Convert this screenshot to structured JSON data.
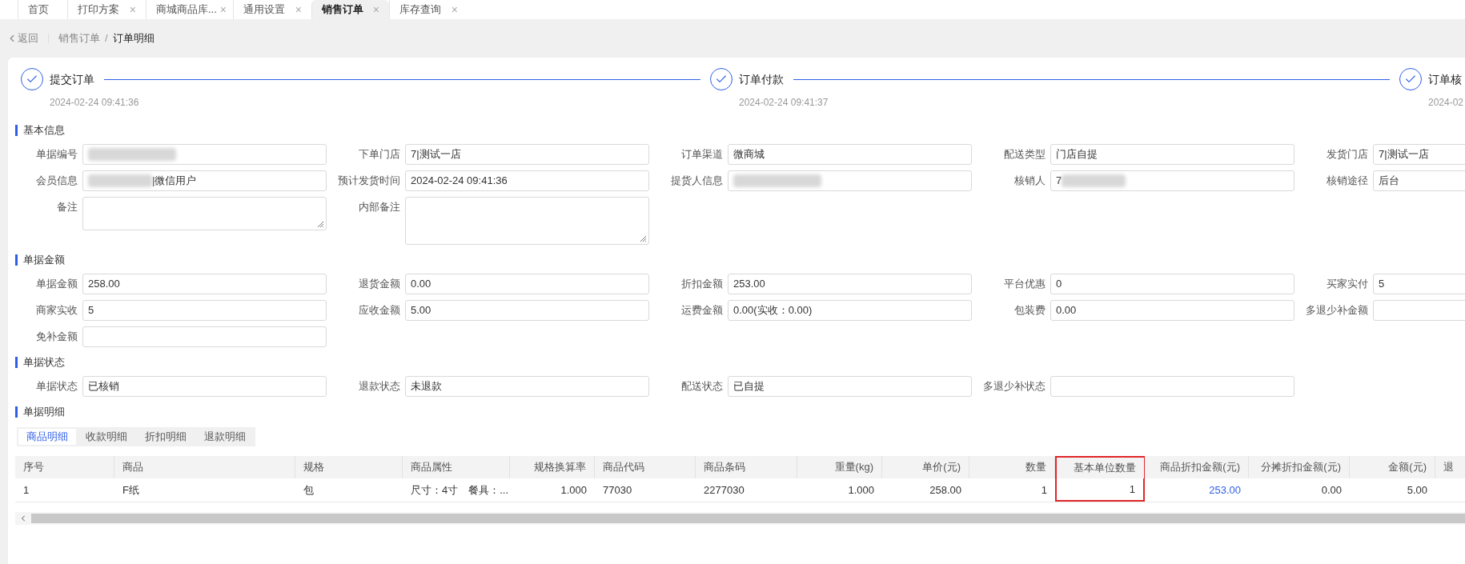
{
  "tabs": [
    {
      "label": "首页",
      "closable": false,
      "selected": false
    },
    {
      "label": "打印方案",
      "closable": true,
      "selected": false
    },
    {
      "label": "商城商品库...",
      "closable": true,
      "selected": false
    },
    {
      "label": "通用设置",
      "closable": true,
      "selected": false
    },
    {
      "label": "销售订单",
      "closable": true,
      "selected": true
    },
    {
      "label": "库存查询",
      "closable": true,
      "selected": false
    }
  ],
  "close_glyph": "×",
  "breadcrumb": {
    "back": "返回",
    "items": [
      "销售订单",
      "订单明细"
    ],
    "separator": "/"
  },
  "steps": [
    {
      "label": "提交订单",
      "time": "2024-02-24 09:41:36",
      "done": true
    },
    {
      "label": "订单付款",
      "time": "2024-02-24 09:41:37",
      "done": true
    },
    {
      "label": "订单核",
      "time": "2024-02",
      "done": true
    }
  ],
  "sections": [
    {
      "title": "基本信息",
      "rows": [
        [
          {
            "label": "单据编号",
            "kind": "input",
            "blur_before": true,
            "blur_after": false
          },
          {
            "label": "下单门店",
            "kind": "input",
            "value": "7|测试一店",
            "blur_before": false,
            "blur_after": false
          },
          {
            "label": "订单渠道",
            "kind": "input",
            "value": "微商城",
            "blur_before": false,
            "blur_after": false
          },
          {
            "label": "配送类型",
            "kind": "input",
            "value": "门店自提",
            "blur_before": false,
            "blur_after": false
          },
          {
            "label": "发货门店",
            "kind": "input",
            "value": "7|测试一店",
            "blur_before": false,
            "blur_after": false
          }
        ],
        [
          {
            "label": "会员信息",
            "kind": "input",
            "value": "|微信用户",
            "blur_before": true,
            "blur_after": false
          },
          {
            "label": "预计发货时间",
            "kind": "input",
            "value": "2024-02-24 09:41:36",
            "blur_before": false,
            "blur_after": false
          },
          {
            "label": "提货人信息",
            "kind": "input",
            "blur_before": true,
            "blur_after": false
          },
          {
            "label": "核销人",
            "kind": "input",
            "value": "7",
            "blur_before": false,
            "blur_after": true
          },
          {
            "label": "核销途径",
            "kind": "input",
            "value": "后台",
            "blur_before": false,
            "blur_after": false
          }
        ],
        [
          {
            "label": "备注",
            "kind": "textarea",
            "blur_before": false,
            "blur_after": false
          },
          {
            "label": "内部备注",
            "kind": "textarea_tall",
            "blur_before": false,
            "blur_after": false
          }
        ]
      ]
    },
    {
      "title": "单据金额",
      "rows": [
        [
          {
            "label": "单据金额",
            "kind": "input",
            "value": "258.00"
          },
          {
            "label": "退货金额",
            "kind": "input",
            "value": "0.00"
          },
          {
            "label": "折扣金额",
            "kind": "input",
            "value": "253.00"
          },
          {
            "label": "平台优惠",
            "kind": "input",
            "value": "0"
          },
          {
            "label": "买家实付",
            "kind": "input",
            "value": "5"
          }
        ],
        [
          {
            "label": "商家实收",
            "kind": "input",
            "value": "5"
          },
          {
            "label": "应收金额",
            "kind": "input",
            "value": "5.00"
          },
          {
            "label": "运费金额",
            "kind": "input",
            "value": "0.00(实收：0.00)"
          },
          {
            "label": "包装费",
            "kind": "input",
            "value": "0.00"
          },
          {
            "label": "多退少补金额",
            "kind": "input"
          }
        ],
        [
          {
            "label": "免补金额",
            "kind": "input"
          }
        ]
      ]
    },
    {
      "title": "单据状态",
      "rows": [
        [
          {
            "label": "单据状态",
            "kind": "input",
            "value": "已核销"
          },
          {
            "label": "退款状态",
            "kind": "input",
            "value": "未退款"
          },
          {
            "label": "配送状态",
            "kind": "input",
            "value": "已自提"
          },
          {
            "label": "多退少补状态",
            "kind": "input"
          }
        ]
      ]
    }
  ],
  "detail": {
    "title": "单据明细",
    "subtabs": [
      {
        "label": "商品明细",
        "selected": true
      },
      {
        "label": "收款明细",
        "selected": false
      },
      {
        "label": "折扣明细",
        "selected": false
      },
      {
        "label": "退款明细",
        "selected": false
      }
    ],
    "table": {
      "columns": [
        {
          "label": "序号",
          "kind": "text",
          "highlighted": false
        },
        {
          "label": "商品",
          "kind": "text",
          "highlighted": false
        },
        {
          "label": "规格",
          "kind": "text",
          "highlighted": false
        },
        {
          "label": "商品属性",
          "kind": "text",
          "highlighted": false
        },
        {
          "label": "规格换算率",
          "kind": "number",
          "highlighted": false
        },
        {
          "label": "商品代码",
          "kind": "text",
          "highlighted": false
        },
        {
          "label": "商品条码",
          "kind": "text",
          "highlighted": false
        },
        {
          "label": "重量(kg)",
          "kind": "number",
          "highlighted": false
        },
        {
          "label": "单价(元)",
          "kind": "number",
          "highlighted": false
        },
        {
          "label": "数量",
          "kind": "number",
          "highlighted": false
        },
        {
          "label": "基本单位数量",
          "kind": "number",
          "highlighted": true
        },
        {
          "label": "商品折扣金额(元)",
          "kind": "link",
          "highlighted": false
        },
        {
          "label": "分摊折扣金额(元)",
          "kind": "number",
          "highlighted": false
        },
        {
          "label": "金额(元)",
          "kind": "number",
          "highlighted": false
        },
        {
          "label": "退",
          "kind": "text",
          "highlighted": false
        }
      ],
      "rows": [
        [
          "1",
          "F纸",
          "包",
          "尺寸：4寸　餐具：...",
          "1.000",
          "77030",
          "2277030",
          "1.000",
          "258.00",
          "1",
          "1",
          "253.00",
          "0.00",
          "5.00"
        ]
      ]
    }
  }
}
